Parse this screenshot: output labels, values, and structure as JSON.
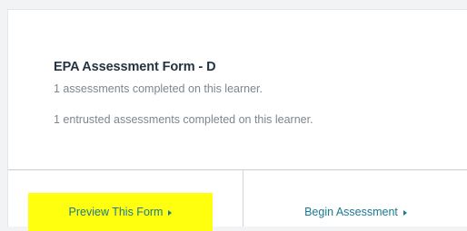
{
  "form": {
    "title": "EPA Assessment Form - D",
    "completed_text": "1 assessments completed on this learner.",
    "entrusted_text": "1 entrusted assessments completed on this learner."
  },
  "actions": {
    "preview_label": "Preview This Form",
    "begin_label": "Begin Assessment",
    "caret_icon": "caret-right-icon"
  },
  "colors": {
    "link": "#1a7a8f",
    "highlight": "#ffff0e",
    "title": "#263340",
    "muted": "#7d868e"
  }
}
